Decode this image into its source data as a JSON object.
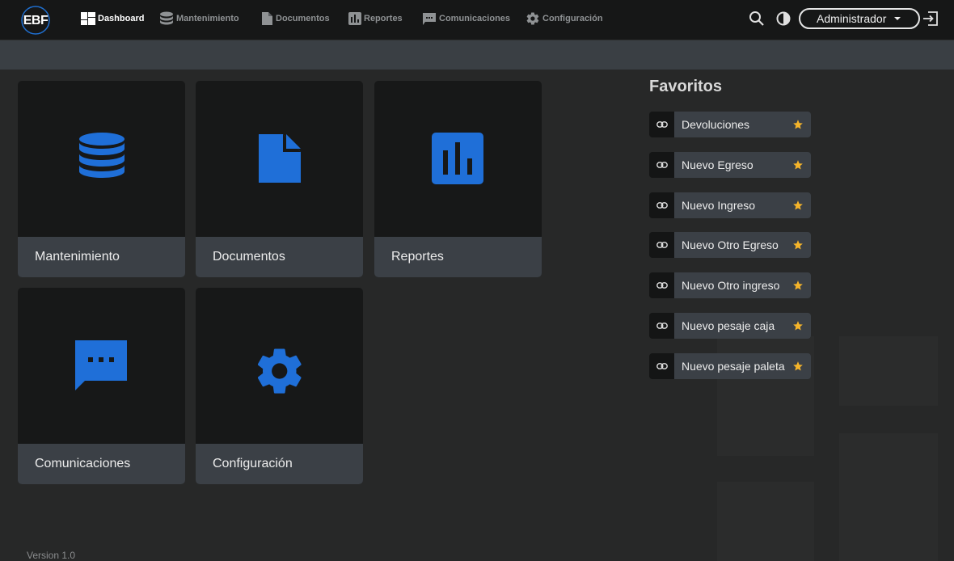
{
  "brand": {
    "logo_text": "EBF",
    "accent": "#1f7ae0"
  },
  "nav": {
    "items": [
      {
        "label": "Dashboard",
        "icon": "dashboard-icon",
        "active": true
      },
      {
        "label": "Mantenimiento",
        "icon": "database-icon"
      },
      {
        "label": "Documentos",
        "icon": "document-icon"
      },
      {
        "label": "Reportes",
        "icon": "bar-chart-icon"
      },
      {
        "label": "Comunicaciones",
        "icon": "chat-icon"
      },
      {
        "label": "Configuración",
        "icon": "gear-icon"
      }
    ],
    "user": {
      "label": "Administrador"
    },
    "actions": [
      "search-icon",
      "contrast-icon",
      "logout-icon"
    ]
  },
  "cards": [
    {
      "label": "Mantenimiento",
      "icon": "database-icon"
    },
    {
      "label": "Documentos",
      "icon": "document-icon"
    },
    {
      "label": "Reportes",
      "icon": "bar-chart-icon"
    },
    {
      "label": "Comunicaciones",
      "icon": "chat-icon"
    },
    {
      "label": "Configuración",
      "icon": "gear-icon"
    }
  ],
  "favorites": {
    "title": "Favoritos",
    "items": [
      {
        "label": "Devoluciones"
      },
      {
        "label": "Nuevo Egreso"
      },
      {
        "label": "Nuevo Ingreso"
      },
      {
        "label": "Nuevo Otro Egreso"
      },
      {
        "label": "Nuevo Otro ingreso"
      },
      {
        "label": "Nuevo pesaje caja"
      },
      {
        "label": "Nuevo pesaje paleta"
      }
    ],
    "star_color": "#f5b42a"
  },
  "footer": {
    "version": "Version 1.0"
  }
}
